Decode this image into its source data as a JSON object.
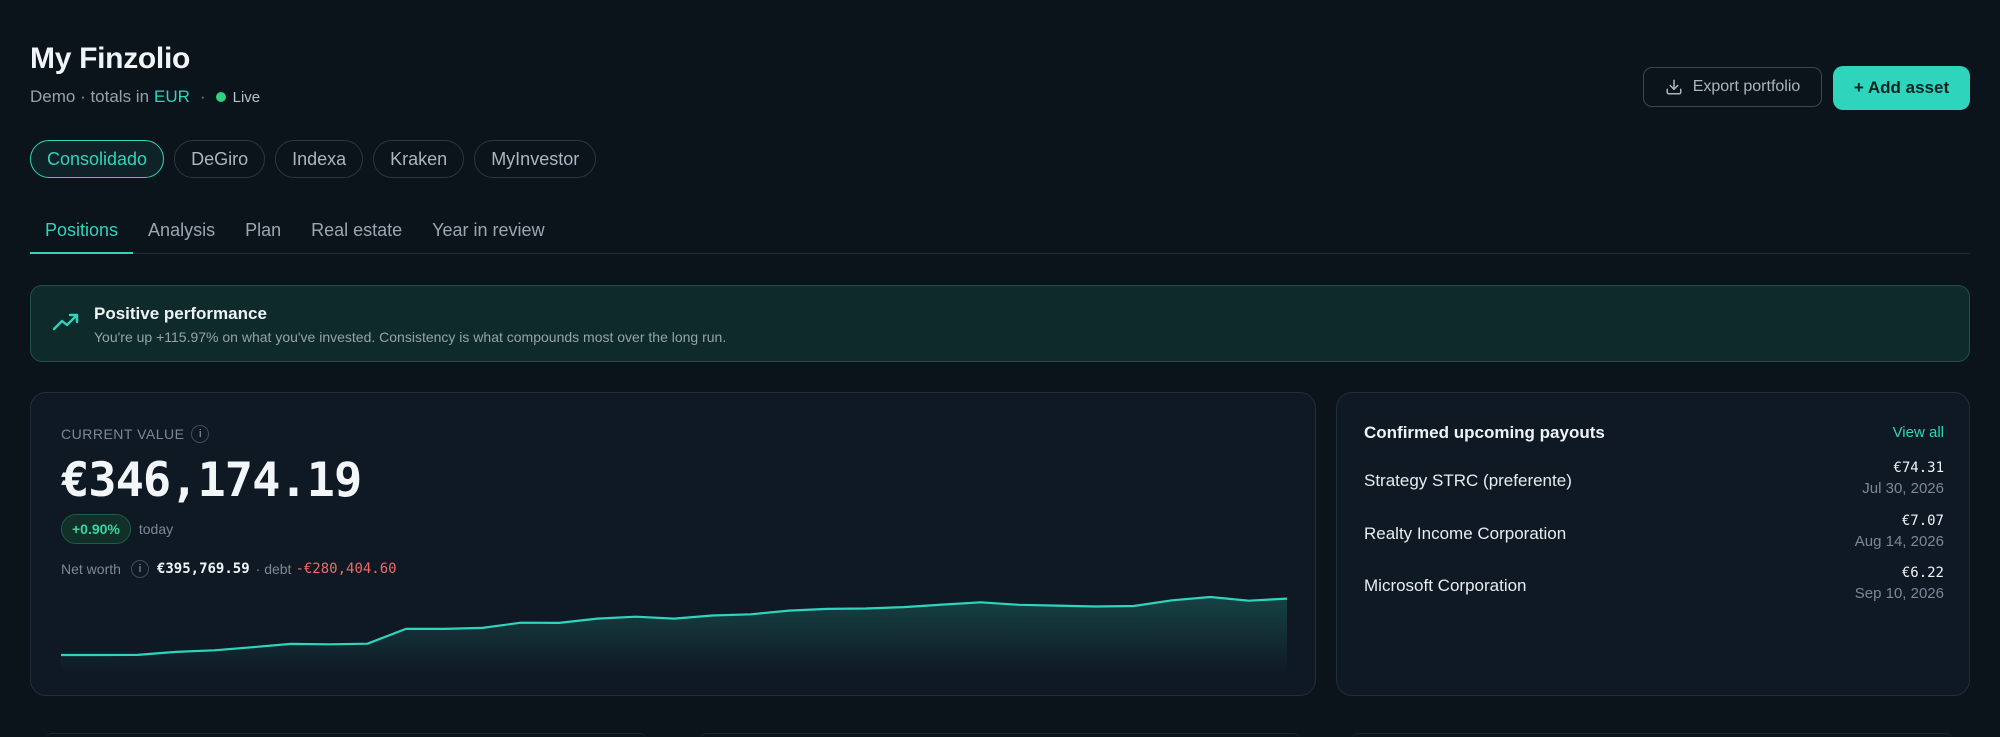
{
  "header": {
    "title": "My Finzolio",
    "subtitle_prefix": "Demo · totals in",
    "currency": "EUR",
    "separator": "·",
    "status": "Live",
    "export_label": "Export portfolio",
    "add_label": "+ Add asset"
  },
  "accounts": [
    "Consolidado",
    "DeGiro",
    "Indexa",
    "Kraken",
    "MyInvestor"
  ],
  "tabs": [
    "Positions",
    "Analysis",
    "Plan",
    "Real estate",
    "Year in review"
  ],
  "banner": {
    "title": "Positive performance",
    "message": "You're up +115.97% on what you've invested. Consistency is what compounds most over the long run."
  },
  "value_card": {
    "label": "CURRENT VALUE",
    "info": "i",
    "value": "€346,174.19",
    "change": "+0.90%",
    "period": "today",
    "net_worth_label": "Net worth",
    "net_worth": "€395,769.59",
    "debt_label": "· debt",
    "debt": "-€280,404.60",
    "sparkline": [
      0,
      0,
      0.05,
      1.5,
      2.3,
      3.8,
      5.4,
      5.2,
      5.5,
      12.7,
      12.7,
      13.2,
      15.7,
      15.6,
      17.7,
      18.6,
      17.7,
      19.2,
      19.8,
      21.6,
      22.4,
      22.6,
      23.3,
      24.5,
      25.6,
      24.4,
      24.0,
      23.6,
      23.8,
      26.6,
      28.2,
      26.4,
      27.4
    ],
    "accent_color": "#2fd4bd"
  },
  "payouts": {
    "title": "Confirmed upcoming payouts",
    "view_all": "View all",
    "items": [
      {
        "name": "Strategy STRC (preferente)",
        "amount": "€74.31",
        "date": "Jul 30, 2026"
      },
      {
        "name": "Realty Income Corporation",
        "amount": "€7.07",
        "date": "Aug 14, 2026"
      },
      {
        "name": "Microsoft Corporation",
        "amount": "€6.22",
        "date": "Sep 10, 2026"
      }
    ]
  },
  "icons": {
    "export": "download-icon",
    "banner": "trending-up-icon",
    "status": "status-dot-icon"
  }
}
